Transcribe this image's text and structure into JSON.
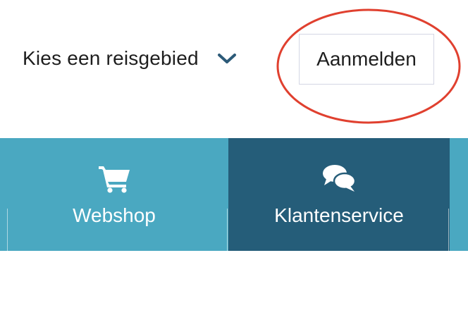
{
  "header": {
    "region_select": {
      "label": "Kies een reisgebied",
      "icon": "chevron-down-icon"
    },
    "login_button": {
      "label": "Aanmelden"
    },
    "annotation": {
      "shape": "ellipse",
      "color": "#e0402f"
    }
  },
  "nav": {
    "items": [
      {
        "label": "Webshop",
        "icon": "shopping-cart-icon",
        "active": false,
        "color": "#4aa8c1"
      },
      {
        "label": "Klantenservice",
        "icon": "chat-bubbles-icon",
        "active": true,
        "color": "#255d79"
      }
    ]
  },
  "colors": {
    "nav_background": "#4aa8c1",
    "nav_active": "#255d79",
    "text_dark": "#1e1e1e",
    "chevron": "#2c5a78"
  }
}
